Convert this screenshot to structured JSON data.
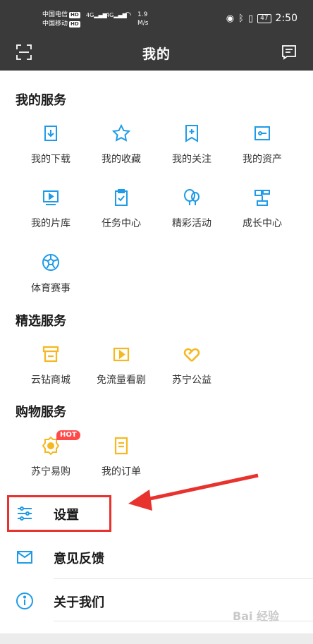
{
  "status_bar": {
    "carrier1": "中国电信",
    "carrier2": "中国移动",
    "hd": "HD",
    "signal1": "4G",
    "signal2": "4G",
    "net_speed_value": "1.9",
    "net_speed_unit": "M/s",
    "battery": "47",
    "time": "2:50"
  },
  "nav": {
    "title": "我的"
  },
  "my_services": {
    "title": "我的服务",
    "items": [
      {
        "label": "我的下载"
      },
      {
        "label": "我的收藏"
      },
      {
        "label": "我的关注"
      },
      {
        "label": "我的资产"
      },
      {
        "label": "我的片库"
      },
      {
        "label": "任务中心"
      },
      {
        "label": "精彩活动"
      },
      {
        "label": "成长中心"
      },
      {
        "label": "体育赛事"
      }
    ]
  },
  "featured_services": {
    "title": "精选服务",
    "items": [
      {
        "label": "云钻商城"
      },
      {
        "label": "免流量看剧"
      },
      {
        "label": "苏宁公益"
      }
    ]
  },
  "shopping_services": {
    "title": "购物服务",
    "items": [
      {
        "label": "苏宁易购",
        "badge": "HOT"
      },
      {
        "label": "我的订单"
      }
    ]
  },
  "menu": [
    {
      "label": "设置"
    },
    {
      "label": "意见反馈"
    },
    {
      "label": "关于我们"
    }
  ],
  "watermark": "Bai 经验",
  "colors": {
    "blue": "#1e9be8",
    "gold": "#f5b820",
    "red": "#e8322e",
    "header": "#3a3a3a"
  }
}
